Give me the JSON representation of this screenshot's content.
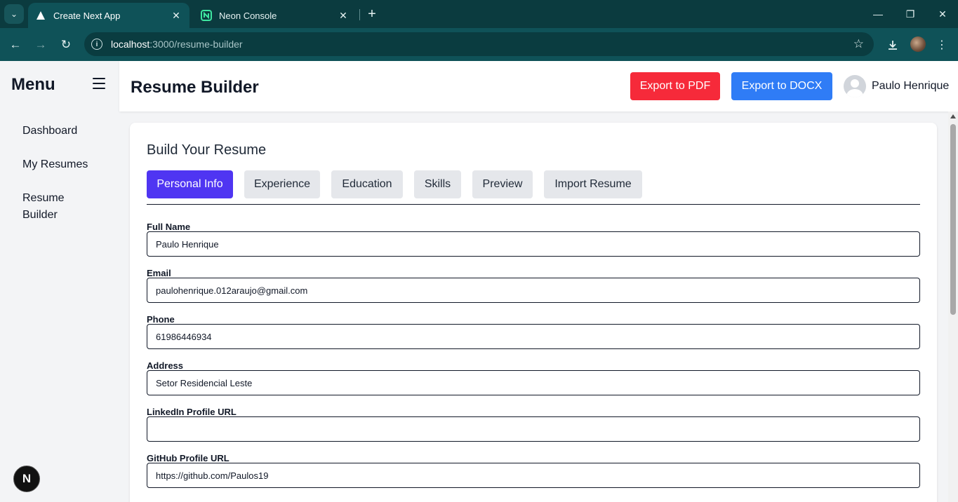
{
  "browser": {
    "tabs": [
      {
        "title": "Create Next App",
        "active": true
      },
      {
        "title": "Neon Console",
        "active": false
      }
    ],
    "url_host": "localhost",
    "url_path": ":3000/resume-builder"
  },
  "sidebar": {
    "title": "Menu",
    "items": [
      {
        "label": "Dashboard"
      },
      {
        "label": "My Resumes"
      },
      {
        "label": "Resume Builder"
      }
    ]
  },
  "header": {
    "title": "Resume Builder",
    "export_pdf": "Export to PDF",
    "export_docx": "Export to DOCX",
    "user_name": "Paulo Henrique"
  },
  "form": {
    "title": "Build Your Resume",
    "tabs": [
      {
        "label": "Personal Info",
        "active": true
      },
      {
        "label": "Experience"
      },
      {
        "label": "Education"
      },
      {
        "label": "Skills"
      },
      {
        "label": "Preview"
      },
      {
        "label": "Import Resume"
      }
    ],
    "fields": [
      {
        "label": "Full Name",
        "value": "Paulo Henrique"
      },
      {
        "label": "Email",
        "value": "paulohenrique.012araujo@gmail.com"
      },
      {
        "label": "Phone",
        "value": "61986446934"
      },
      {
        "label": "Address",
        "value": "Setor Residencial Leste"
      },
      {
        "label": "LinkedIn Profile URL",
        "value": ""
      },
      {
        "label": "GitHub Profile URL",
        "value": "https://github.com/Paulos19"
      }
    ]
  },
  "badge": {
    "label": "N"
  },
  "colors": {
    "accent_tab": "#4f35f2",
    "export_pdf": "#f62a3a",
    "export_docx": "#2f7cf6",
    "chrome_bg": "#0b3b3f"
  }
}
